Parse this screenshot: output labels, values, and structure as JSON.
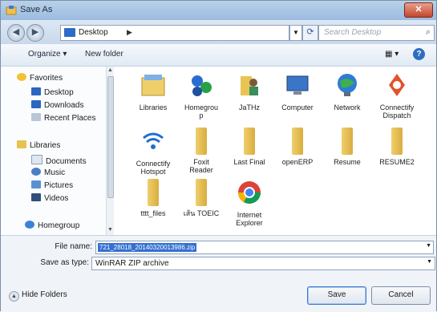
{
  "window": {
    "title": "Save As",
    "close_glyph": "✕"
  },
  "nav": {
    "back_glyph": "◀",
    "forward_glyph": "▶",
    "address": [
      "Desktop",
      "▶"
    ],
    "search_placeholder": "Search Desktop"
  },
  "toolbar": {
    "organize": "Organize ▾",
    "new_folder": "New folder",
    "view": "▦ ▾",
    "help": "?"
  },
  "sidebar": {
    "favorites": "Favorites",
    "fav_items": [
      "Desktop",
      "Downloads",
      "Recent Places"
    ],
    "libraries": "Libraries",
    "lib_items": [
      "Documents",
      "Music",
      "Pictures",
      "Videos"
    ],
    "homegroup": "Homegroup"
  },
  "content": {
    "items": [
      {
        "label": "Libraries",
        "icon": "libraries-icon"
      },
      {
        "label": "Homegrou\np",
        "icon": "homegroup-icon"
      },
      {
        "label": "JaTHz",
        "icon": "user-folder-icon"
      },
      {
        "label": "Computer",
        "icon": "computer-icon"
      },
      {
        "label": "Network",
        "icon": "network-icon"
      },
      {
        "label": "Connectify\nDispatch",
        "icon": "connectify-dispatch-icon"
      },
      {
        "label": "Connectify\nHotspot",
        "icon": "wifi-icon"
      },
      {
        "label": "Foxit\nReader",
        "icon": "folder-icon"
      },
      {
        "label": "Last Final",
        "icon": "folder-icon"
      },
      {
        "label": "openERP",
        "icon": "folder-icon"
      },
      {
        "label": "Resume",
        "icon": "folder-icon"
      },
      {
        "label": "RESUME2",
        "icon": "folder-icon"
      },
      {
        "label": "tttt_files",
        "icon": "folder-icon"
      },
      {
        "label": "เส้น TOEIC",
        "icon": "folder-icon"
      },
      {
        "label": "Internet\nExplorer",
        "icon": "chrome-icon"
      }
    ]
  },
  "form": {
    "filename_label": "File name:",
    "filename_value": "721_28018_20140320013986.zip",
    "savetype_label": "Save as type:",
    "savetype_value": "WinRAR ZIP archive"
  },
  "footer": {
    "hide_folders": "Hide Folders",
    "save": "Save",
    "cancel": "Cancel"
  },
  "colors": {
    "accent": "#3470d0",
    "titlebar": "#9bbbe0",
    "close": "#c4452c"
  }
}
